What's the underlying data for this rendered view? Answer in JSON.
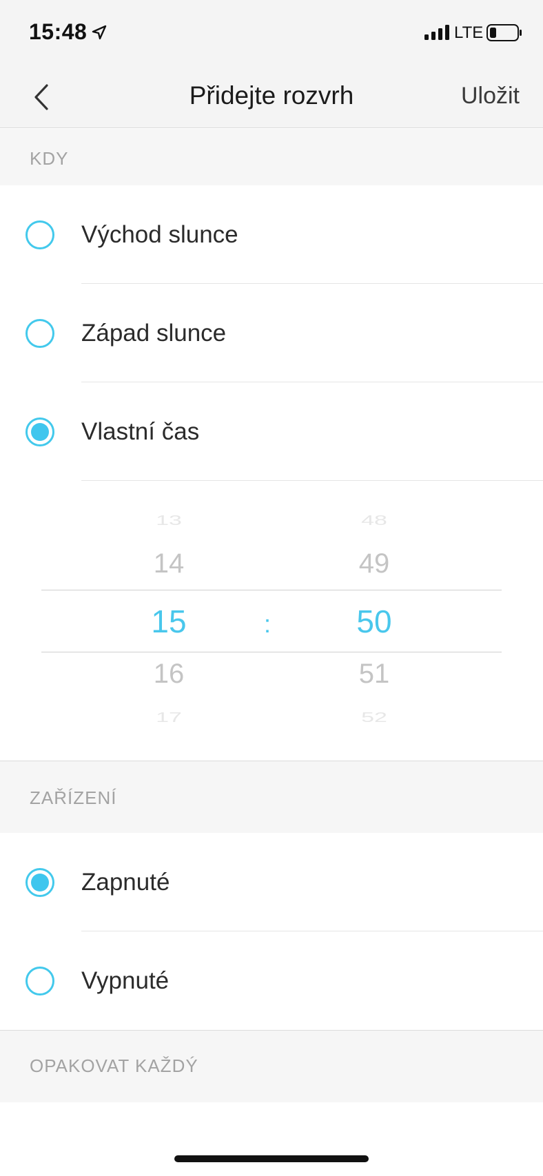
{
  "status_bar": {
    "time": "15:48",
    "network": "LTE",
    "icons": [
      "location-arrow-icon",
      "signal-icon",
      "battery-icon"
    ]
  },
  "nav": {
    "title": "Přidejte rozvrh",
    "save_label": "Uložit",
    "back_icon": "chevron-left-icon"
  },
  "sections": {
    "when": {
      "header": "KDY",
      "options": [
        {
          "label": "Východ slunce",
          "selected": false
        },
        {
          "label": "Západ slunce",
          "selected": false
        },
        {
          "label": "Vlastní čas",
          "selected": true
        }
      ]
    },
    "device": {
      "header": "ZAŘÍZENÍ",
      "options": [
        {
          "label": "Zapnuté",
          "selected": true
        },
        {
          "label": "Vypnuté",
          "selected": false
        }
      ]
    },
    "repeat": {
      "header": "OPAKOVAT KAŽDÝ"
    }
  },
  "time_picker": {
    "separator": ":",
    "hours": [
      "13",
      "14",
      "15",
      "16",
      "17"
    ],
    "minutes": [
      "48",
      "49",
      "50",
      "51",
      "52"
    ],
    "selected_hour": "15",
    "selected_minute": "50"
  },
  "colors": {
    "accent": "#43c9ec",
    "section_bg": "#f6f6f6",
    "header_text": "#a3a3a3"
  }
}
